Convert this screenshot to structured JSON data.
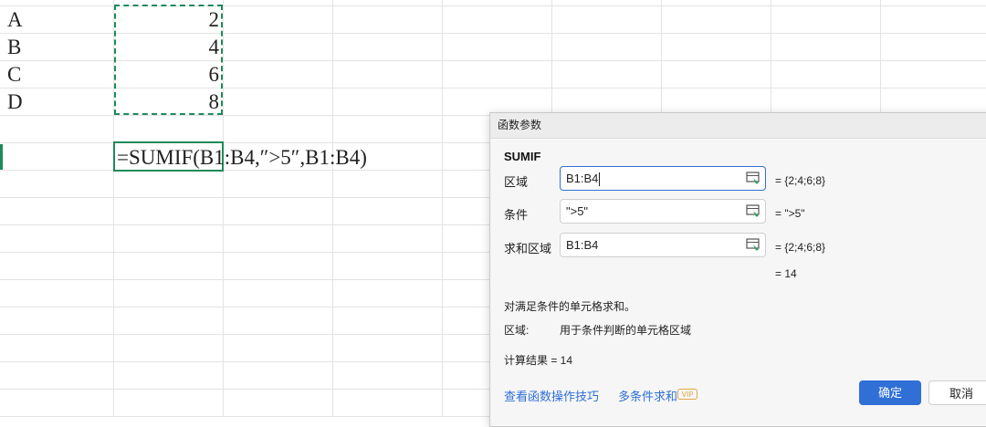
{
  "sheet": {
    "rows": [
      {
        "label": "A",
        "value": "2"
      },
      {
        "label": "B",
        "value": "4"
      },
      {
        "label": "C",
        "value": "6"
      },
      {
        "label": "D",
        "value": "8"
      }
    ],
    "formula": "=SUMIF(B1:B4,″>5″,B1:B4)"
  },
  "dialog": {
    "title": "函数参数",
    "function_name": "SUMIF",
    "args": [
      {
        "label": "区域",
        "value": "B1:B4",
        "result": "= {2;4;6;8}"
      },
      {
        "label": "条件",
        "value": "\">5\"",
        "result": "= \">5\""
      },
      {
        "label": "求和区域",
        "value": "B1:B4",
        "result": "= {2;4;6;8}"
      }
    ],
    "total_result": "= 14",
    "description": "对满足条件的单元格求和。",
    "param_label": "区域:",
    "param_desc": "用于条件判断的单元格区域",
    "calc_result": "计算结果  =  14",
    "help_link": "查看函数操作技巧",
    "multi_link": "多条件求和",
    "vip_badge": "VIP",
    "ok_label": "确定",
    "cancel_label": "取消"
  },
  "colors": {
    "accent": "#2f6fd6",
    "selection": "#1f8a5b"
  }
}
